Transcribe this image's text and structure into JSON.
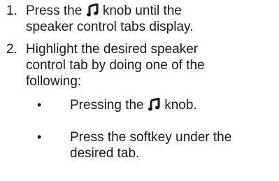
{
  "steps": [
    {
      "number": "1.",
      "line1_before": "Press the",
      "line1_after": "knob until the",
      "line2": "speaker control tabs display."
    },
    {
      "number": "2.",
      "line1": "Highlight the desired speaker",
      "line2": "control tab by doing one of the",
      "line3": "following:"
    }
  ],
  "bullets": [
    {
      "symbol": "•",
      "line1_before": "Pressing the",
      "line1_after": "knob."
    },
    {
      "symbol": "•",
      "line1": "Press the softkey under the",
      "line2": "desired tab."
    }
  ],
  "icons": {
    "knob_icon": "music-note-icon"
  }
}
